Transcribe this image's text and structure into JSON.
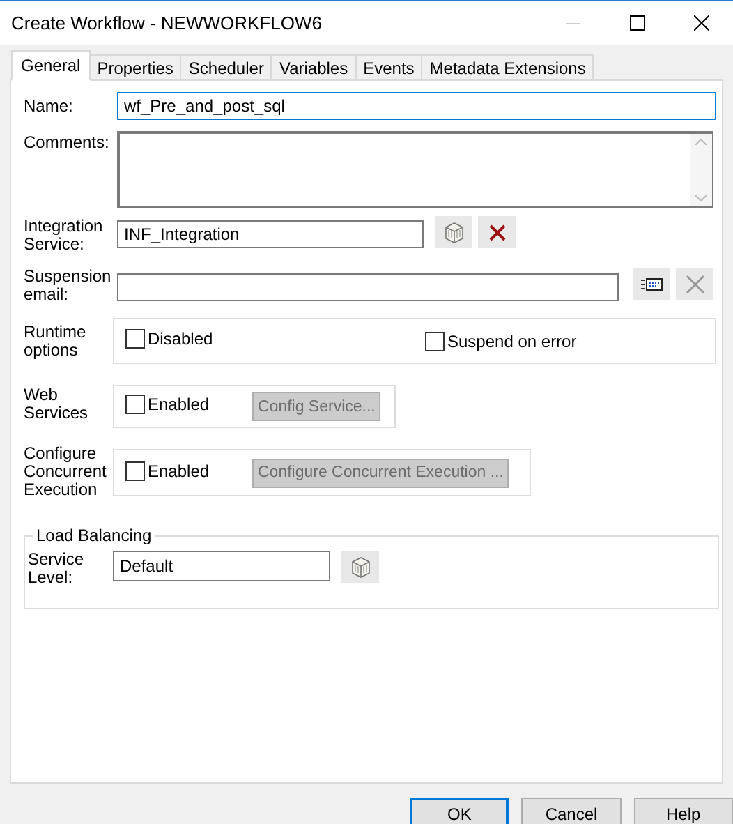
{
  "window": {
    "title": "Create Workflow - NEWWORKFLOW6"
  },
  "tabs": [
    {
      "label": "General",
      "selected": true
    },
    {
      "label": "Properties",
      "selected": false
    },
    {
      "label": "Scheduler",
      "selected": false
    },
    {
      "label": "Variables",
      "selected": false
    },
    {
      "label": "Events",
      "selected": false
    },
    {
      "label": "Metadata Extensions",
      "selected": false
    }
  ],
  "general": {
    "name": {
      "label": "Name:",
      "value": "wf_Pre_and_post_sql",
      "focused": true
    },
    "comments": {
      "label": "Comments:"
    },
    "integration_service": {
      "label": "Integration Service:",
      "value": "INF_Integration"
    },
    "suspension_email": {
      "label": "Suspension email:"
    },
    "runtime_options": {
      "label": "Runtime options",
      "options": [
        {
          "label": "Disabled",
          "checked": false
        },
        {
          "label": "Suspend on error",
          "checked": false
        }
      ]
    },
    "web_services": {
      "label": "Web Services",
      "enabled": {
        "label": "Enabled",
        "checked": false
      },
      "button": {
        "label": "Config Service...",
        "disabled": true
      }
    },
    "concurrent_execution": {
      "label": "Configure Concurrent Execution",
      "enabled": {
        "label": "Enabled",
        "checked": false
      },
      "button": {
        "label": "Configure Concurrent Execution ...",
        "disabled": true
      }
    },
    "load_balancing": {
      "title": "Load Balancing",
      "service_level": {
        "label": "Service Level:",
        "value": "Default"
      }
    }
  },
  "buttons": [
    {
      "label": "OK",
      "default": true
    },
    {
      "label": "Cancel",
      "default": false
    },
    {
      "label": "Help",
      "default": false
    }
  ]
}
